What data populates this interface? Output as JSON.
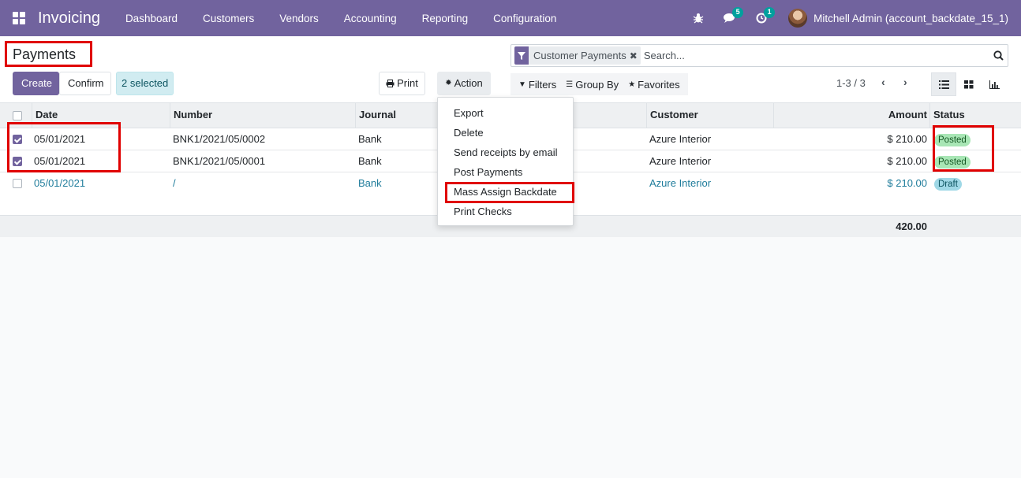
{
  "navbar": {
    "brand": "Invoicing",
    "menu": [
      "Dashboard",
      "Customers",
      "Vendors",
      "Accounting",
      "Reporting",
      "Configuration"
    ],
    "messages_count": "5",
    "activities_count": "1",
    "user": "Mitchell Admin (account_backdate_15_1)"
  },
  "control_panel": {
    "title": "Payments",
    "create_label": "Create",
    "confirm_label": "Confirm",
    "selected_label": "2 selected",
    "print_label": "Print",
    "action_label": "Action",
    "search_facet": "Customer Payments",
    "search_placeholder": "Search...",
    "filters_label": "Filters",
    "groupby_label": "Group By",
    "favorites_label": "Favorites",
    "pager": "1-3 / 3"
  },
  "table": {
    "headers": {
      "date": "Date",
      "number": "Number",
      "journal": "Journal",
      "customer": "Customer",
      "amount": "Amount",
      "status": "Status"
    },
    "rows": [
      {
        "date": "05/01/2021",
        "number": "BNK1/2021/05/0002",
        "journal": "Bank",
        "customer": "Azure Interior",
        "amount": "$ 210.00",
        "status": "Posted"
      },
      {
        "date": "05/01/2021",
        "number": "BNK1/2021/05/0001",
        "journal": "Bank",
        "customer": "Azure Interior",
        "amount": "$ 210.00",
        "status": "Posted"
      },
      {
        "date": "05/01/2021",
        "number": "/",
        "journal": "Bank",
        "customer": "Azure Interior",
        "amount": "$ 210.00",
        "status": "Draft"
      }
    ],
    "total": "420.00"
  },
  "action_menu": {
    "items": [
      "Export",
      "Delete",
      "Send receipts by email",
      "Post Payments",
      "Mass Assign Backdate",
      "Print Checks"
    ]
  },
  "colors": {
    "brand": "#71639e",
    "highlight": "#e00000",
    "link": "#1f7c9b"
  }
}
